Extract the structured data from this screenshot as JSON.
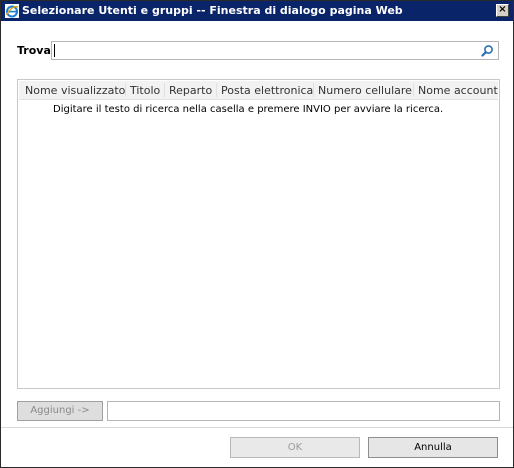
{
  "window": {
    "title": "Selezionare Utenti e gruppi -- Finestra di dialogo pagina Web",
    "close_label": "×"
  },
  "search": {
    "label": "Trova",
    "value": "",
    "icon": "search-icon"
  },
  "results": {
    "columns": [
      "Nome visualizzato",
      "Titolo",
      "Reparto",
      "Posta elettronica",
      "Numero cellulare",
      "Nome account"
    ],
    "hint": "Digitare il testo di ricerca nella casella e premere INVIO per avviare la ricerca."
  },
  "add": {
    "button_label": "Aggiungi ->",
    "value": ""
  },
  "footer": {
    "ok_label": "OK",
    "cancel_label": "Annulla"
  },
  "colors": {
    "titlebar": "#0a246a",
    "panel_header": "#f2f2f2"
  }
}
